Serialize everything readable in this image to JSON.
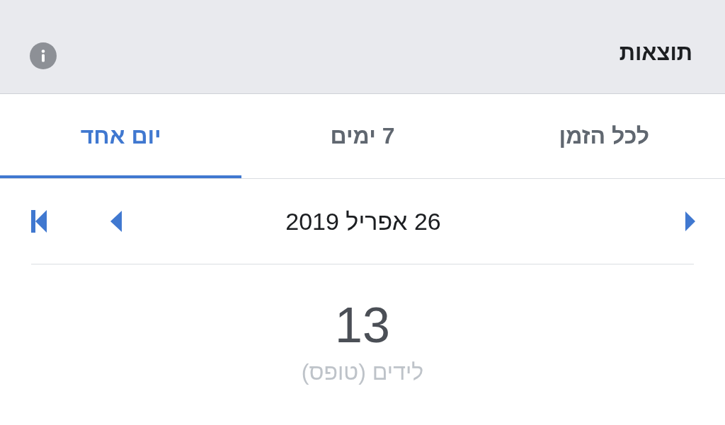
{
  "header": {
    "title": "תוצאות"
  },
  "tabs": [
    {
      "label": "לכל הזמן",
      "selected": false
    },
    {
      "label": "7 ימים",
      "selected": false
    },
    {
      "label": "יום אחד",
      "selected": true
    }
  ],
  "date_nav": {
    "date": "26 אפריל 2019"
  },
  "metric": {
    "value": "13",
    "label": "לידים (טופס)"
  }
}
